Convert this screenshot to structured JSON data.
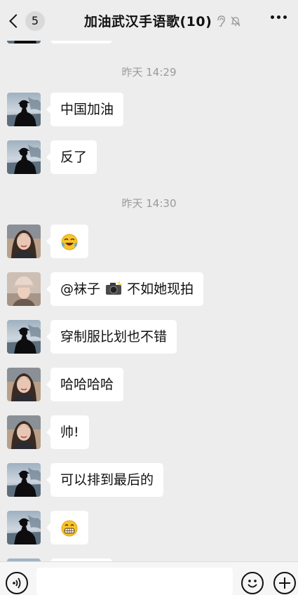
{
  "header": {
    "back_count": "5",
    "title": "加油武汉手语歌(10)",
    "icons": [
      "back-chevron-icon",
      "ear-icon",
      "mute-bell-icon",
      "more-icon"
    ]
  },
  "timestamps": {
    "t1": "昨天 14:29",
    "t2": "昨天 14:30"
  },
  "messages": [
    {
      "text": "中国加油",
      "avatar": "silhouette-avatar"
    },
    {
      "text": "反了",
      "avatar": "silhouette-avatar"
    },
    {
      "text": "",
      "emoji": "laughing-crying-emoji",
      "avatar": "woman-avatar"
    },
    {
      "text_before": "@袜子",
      "emoji": "camera-flash-emoji",
      "text_after": " 不如她现拍",
      "avatar": "hat-avatar"
    },
    {
      "text": "穿制服比划也不错",
      "avatar": "silhouette-avatar"
    },
    {
      "text": "哈哈哈哈",
      "avatar": "woman-avatar"
    },
    {
      "text": "帅!",
      "avatar": "woman-avatar"
    },
    {
      "text": "可以排到最后的",
      "avatar": "silhouette-avatar"
    },
    {
      "text": "",
      "emoji": "grinning-emoji",
      "avatar": "silhouette-avatar"
    }
  ],
  "input": {
    "placeholder": ""
  },
  "colors": {
    "background": "#ededed",
    "bubble": "#ffffff",
    "time": "#9a9a9a"
  }
}
